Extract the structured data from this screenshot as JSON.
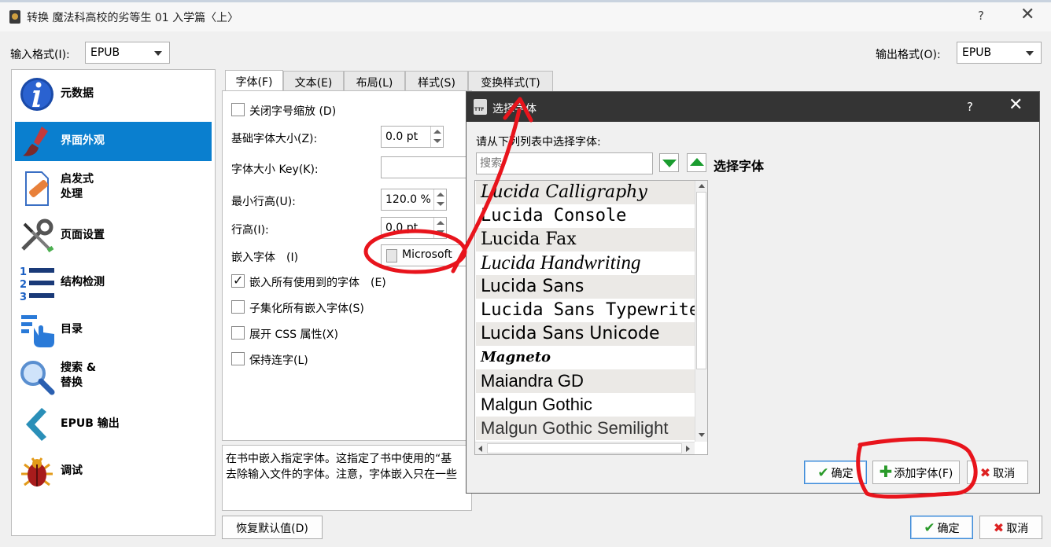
{
  "window": {
    "title": "转换 魔法科高校的劣等生 01 入学篇〈上〉",
    "help": "?",
    "close": "✕"
  },
  "input_format": {
    "label": "输入格式(I):",
    "value": "EPUB"
  },
  "output_format": {
    "label": "输出格式(O):",
    "value": "EPUB"
  },
  "sidebar": {
    "items": [
      {
        "label": "元数据",
        "icon": "info-icon"
      },
      {
        "label": "界面外观",
        "icon": "brush-icon",
        "selected": true
      },
      {
        "label": "启发式",
        "label2": "处理",
        "icon": "document-bandage-icon"
      },
      {
        "label": "页面设置",
        "icon": "tools-icon"
      },
      {
        "label": "结构检测",
        "icon": "numbered-list-icon"
      },
      {
        "label": "目录",
        "icon": "toc-pointer-icon"
      },
      {
        "label": "搜索 &",
        "label2": "替换",
        "icon": "magnifier-icon"
      },
      {
        "label": "EPUB 输出",
        "icon": "chevron-left-icon"
      },
      {
        "label": "调试",
        "icon": "bug-icon"
      }
    ]
  },
  "tabs": [
    "字体(F)",
    "文本(E)",
    "布局(L)",
    "样式(S)",
    "变换样式(T)"
  ],
  "font_panel": {
    "disable_rescale": "关闭字号缩放 (D)",
    "base_font_size_label": "基础字体大小(Z):",
    "base_font_size_value": "0.0 pt",
    "font_size_key_label": "字体大小 Key(K):",
    "font_size_key_value": "",
    "min_line_height_label": "最小行高(U):",
    "min_line_height_value": "120.0 %",
    "line_height_label": "行高(I):",
    "line_height_value": "0.0 pt",
    "embed_font_label": "嵌入字体　(I)",
    "embed_font_value": "Microsoft",
    "embed_all_fonts": "嵌入所有使用到的字体　(E)",
    "embed_all_fonts_checked": true,
    "subset_fonts": "子集化所有嵌入字体(S)",
    "expand_css": "展开 CSS 属性(X)",
    "keep_ligatures": "保持连字(L)"
  },
  "help_text": {
    "line1": "在书中嵌入指定字体。这指定了书中使用的“基",
    "line2": "去除输入文件的字体。注意，字体嵌入只在一些"
  },
  "bottom_buttons": {
    "restore_defaults": "恢复默认值(D)",
    "ok": "确定",
    "cancel": "取消"
  },
  "dialog": {
    "title": "选择字体",
    "help": "?",
    "close": "✕",
    "prompt": "请从下列列表中选择字体:",
    "search_placeholder": "搜索",
    "selected_font_label": "选择字体",
    "fonts": [
      "Lucida Calligraphy",
      "Lucida Console",
      "Lucida Fax",
      "Lucida Handwriting",
      "Lucida Sans",
      "Lucida Sans Typewriter",
      "Lucida Sans Unicode",
      "Magneto",
      "Maiandra GD",
      "Malgun Gothic",
      "Malgun Gothic Semilight"
    ],
    "buttons": {
      "ok": "确定",
      "add_font": "添加字体(F)",
      "cancel": "取消"
    }
  },
  "colors": {
    "accent": "#0a7fcf",
    "annotation": "#e8141c",
    "green_arrow": "#1a9c2f",
    "dialog_titlebar": "#343434"
  }
}
